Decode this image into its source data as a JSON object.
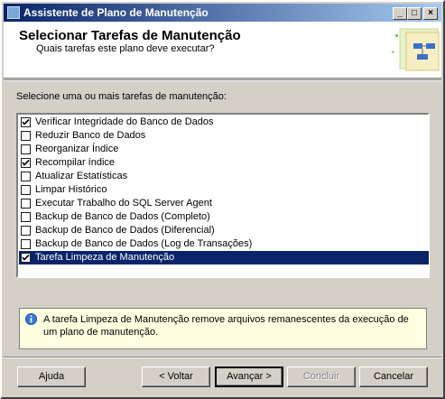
{
  "window": {
    "title": "Assistente de Plano de Manutenção"
  },
  "titlebar_buttons": {
    "minimize": "_",
    "maximize": "□",
    "close": "×"
  },
  "header": {
    "title": "Selecionar Tarefas de Manutenção",
    "subtitle": "Quais tarefas este plano deve executar?"
  },
  "prompt": "Selecione uma ou mais tarefas de manutenção:",
  "tasks": [
    {
      "label": "Verificar Integridade do Banco de Dados",
      "checked": true,
      "selected": false
    },
    {
      "label": "Reduzir Banco de Dados",
      "checked": false,
      "selected": false
    },
    {
      "label": "Reorganizar Índice",
      "checked": false,
      "selected": false
    },
    {
      "label": "Recompilar índice",
      "checked": true,
      "selected": false
    },
    {
      "label": "Atualizar Estatísticas",
      "checked": false,
      "selected": false
    },
    {
      "label": "Limpar Histórico",
      "checked": false,
      "selected": false
    },
    {
      "label": "Executar Trabalho do SQL Server Agent",
      "checked": false,
      "selected": false
    },
    {
      "label": "Backup de Banco de Dados (Completo)",
      "checked": false,
      "selected": false
    },
    {
      "label": "Backup de Banco de Dados (Diferencial)",
      "checked": false,
      "selected": false
    },
    {
      "label": "Backup de Banco de Dados (Log de Transações)",
      "checked": false,
      "selected": false
    },
    {
      "label": "Tarefa Limpeza de Manutenção",
      "checked": true,
      "selected": true
    }
  ],
  "info": {
    "icon": "info-icon",
    "text": "A tarefa Limpeza de Manutenção remove arquivos remanescentes da execução de um plano de manutenção."
  },
  "buttons": {
    "help": "Ajuda",
    "back": "< Voltar",
    "next": "Avançar >",
    "finish": "Concluir",
    "cancel": "Cancelar"
  },
  "colors": {
    "selection": "#0a246a",
    "info_background": "#ffffe1",
    "title_gradient_start": "#0a246a",
    "title_gradient_end": "#a6caf0"
  }
}
